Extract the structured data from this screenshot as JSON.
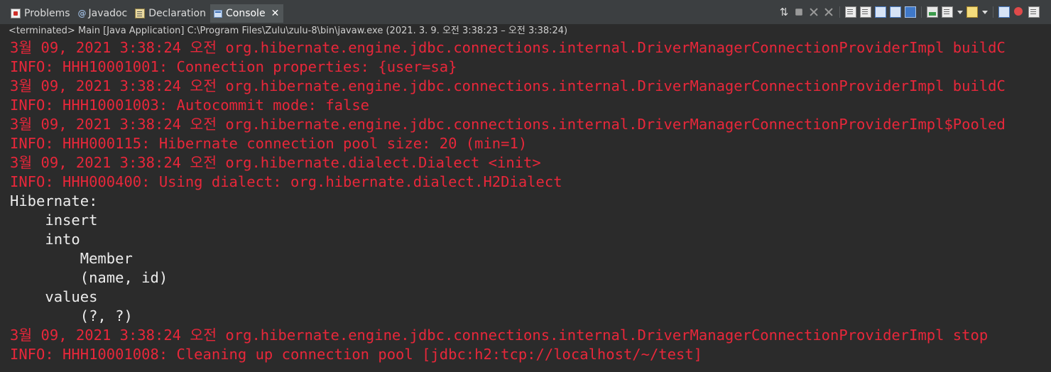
{
  "tabs": [
    {
      "label": "Problems",
      "icon": "problems-icon",
      "active": false
    },
    {
      "label": "Javadoc",
      "icon": "javadoc-icon",
      "active": false
    },
    {
      "label": "Declaration",
      "icon": "declaration-icon",
      "active": false
    },
    {
      "label": "Console",
      "icon": "console-icon",
      "active": true
    }
  ],
  "status_line": "<terminated> Main [Java Application] C:\\Program Files\\Zulu\\zulu-8\\bin\\javaw.exe  (2021. 3. 9. 오전 3:38:23 – 오전 3:38:24)",
  "console": {
    "lines": [
      {
        "text": "3월 09, 2021 3:38:24 오전 org.hibernate.engine.jdbc.connections.internal.DriverManagerConnectionProviderImpl buildC",
        "type": "err"
      },
      {
        "text": "INFO: HHH10001001: Connection properties: {user=sa}",
        "type": "err"
      },
      {
        "text": "3월 09, 2021 3:38:24 오전 org.hibernate.engine.jdbc.connections.internal.DriverManagerConnectionProviderImpl buildC",
        "type": "err"
      },
      {
        "text": "INFO: HHH10001003: Autocommit mode: false",
        "type": "err"
      },
      {
        "text": "3월 09, 2021 3:38:24 오전 org.hibernate.engine.jdbc.connections.internal.DriverManagerConnectionProviderImpl$Pooled",
        "type": "err"
      },
      {
        "text": "INFO: HHH000115: Hibernate connection pool size: 20 (min=1)",
        "type": "err"
      },
      {
        "text": "3월 09, 2021 3:38:24 오전 org.hibernate.dialect.Dialect <init>",
        "type": "err"
      },
      {
        "text": "INFO: HHH000400: Using dialect: org.hibernate.dialect.H2Dialect",
        "type": "err"
      },
      {
        "text": "Hibernate: ",
        "type": "out"
      },
      {
        "text": "    insert ",
        "type": "out"
      },
      {
        "text": "    into",
        "type": "out"
      },
      {
        "text": "        Member",
        "type": "out"
      },
      {
        "text": "        (name, id) ",
        "type": "out"
      },
      {
        "text": "    values",
        "type": "out"
      },
      {
        "text": "        (?, ?)",
        "type": "out"
      },
      {
        "text": "3월 09, 2021 3:38:24 오전 org.hibernate.engine.jdbc.connections.internal.DriverManagerConnectionProviderImpl stop",
        "type": "err"
      },
      {
        "text": "INFO: HHH10001008: Cleaning up connection pool [jdbc:h2:tcp://localhost/~/test]",
        "type": "err"
      }
    ]
  },
  "toolbar_icons": [
    "pin-sync-icon",
    "terminate-icon",
    "remove-launch-icon",
    "remove-all-terminated-icon",
    "word-wrap-icon",
    "scroll-lock-icon",
    "show-stdout-icon",
    "show-stderr-icon",
    "pin-console-icon",
    "display-selected-console-icon",
    "display-console-menu-icon",
    "open-console-icon",
    "open-console-menu-icon",
    "new-console-icon",
    "minimize-icon",
    "maximize-icon"
  ],
  "colors": {
    "stderr": "#e8273a",
    "stdout": "#ececec",
    "background": "#2b2b2b",
    "tabbar": "#3c3f41",
    "active_tab": "#515658"
  }
}
